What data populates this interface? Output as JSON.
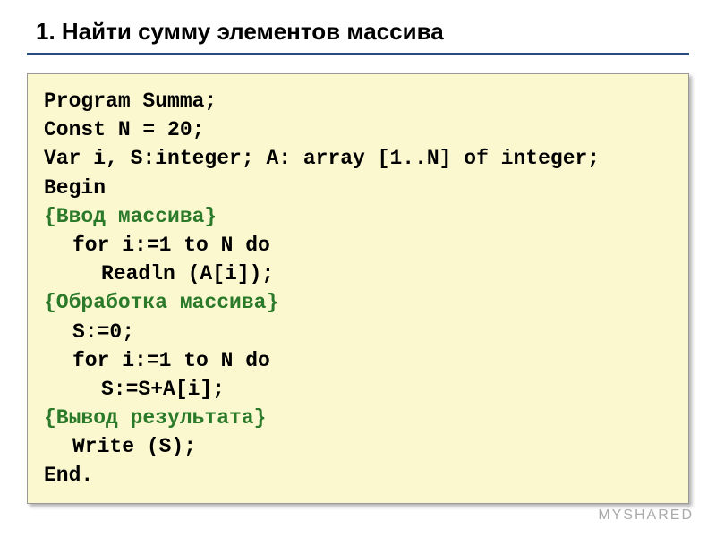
{
  "title": "1.  Найти сумму элементов массива",
  "code": {
    "line1": "Program Summa;",
    "line2": "Const N = 20;",
    "line3": "Var i, S:integer; A: array [1..N] of integer;",
    "line4": "Begin",
    "line5": "{Ввод массива}",
    "line6": "for i:=1 to N do",
    "line7": "Readln (A[i]);",
    "line8": "{Обработка массива}",
    "line9": "S:=0;",
    "line10": "for i:=1 to N do",
    "line11": "S:=S+A[i];",
    "line12": "{Вывод результата}",
    "line13": "Write (S);",
    "line14": "End."
  },
  "watermark": "MYSHARED"
}
